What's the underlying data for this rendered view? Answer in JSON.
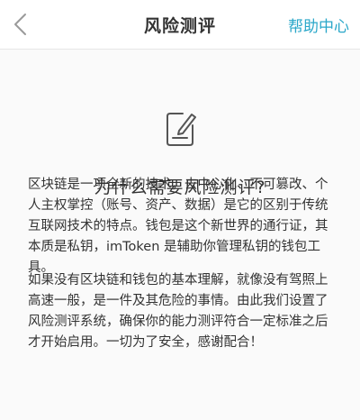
{
  "nav": {
    "title": "风险测评",
    "help_label": "帮助中心",
    "back_icon": "chevron-left-icon",
    "accent_color": "#2aa7c9"
  },
  "main": {
    "icon": "document-edit-icon",
    "heading": "为什么需要风险测评?",
    "paragraphs": [
      "区块链是一项全新的技术，去中心化、不可篡改、个人主权掌控（账号、资产、数据）是它的区别于传统互联网技术的特点。钱包是这个新世界的通行证，其本质是私钥，imToken 是辅助你管理私钥的钱包工具。",
      "如果没有区块链和钱包的基本理解，就像没有驾照上高速一般，是一件及其危险的事情。由此我们设置了风险测评系统，确保你的能力测评符合一定标准之后才开始启用。一切为了安全，感谢配合！"
    ]
  }
}
